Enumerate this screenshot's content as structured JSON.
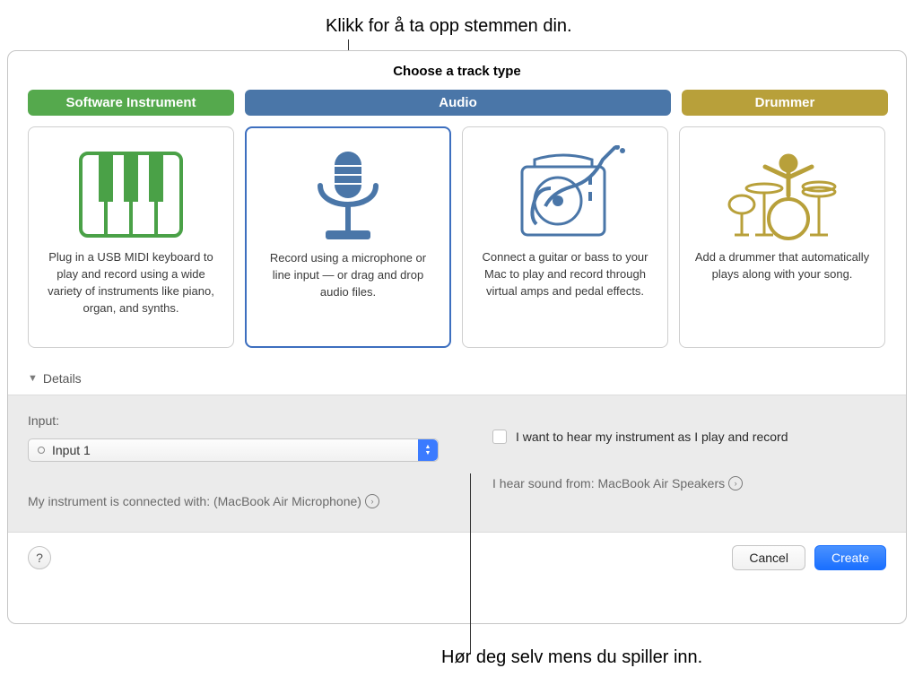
{
  "callouts": {
    "top": "Klikk for å ta opp stemmen din.",
    "bottom": "Hør deg selv mens du spiller inn."
  },
  "header": {
    "title": "Choose a track type"
  },
  "categories": {
    "software": "Software Instrument",
    "audio": "Audio",
    "drummer": "Drummer"
  },
  "cards": {
    "software": {
      "desc": "Plug in a USB MIDI keyboard to play and record using a wide variety of instruments like piano, organ, and synths."
    },
    "mic": {
      "desc": "Record using a microphone or line input — or drag and drop audio files."
    },
    "guitar": {
      "desc": "Connect a guitar or bass to your Mac to play and record through virtual amps and pedal effects."
    },
    "drummer": {
      "desc": "Add a drummer that automatically plays along with your song."
    }
  },
  "details": {
    "label": "Details",
    "input_label": "Input:",
    "input_value": "Input 1",
    "connected_text": "My instrument is connected with: (MacBook Air Microphone)",
    "monitor_text": "I want to hear my instrument as I play and record",
    "output_text": "I hear sound from: MacBook Air Speakers"
  },
  "footer": {
    "help": "?",
    "cancel": "Cancel",
    "create": "Create"
  }
}
